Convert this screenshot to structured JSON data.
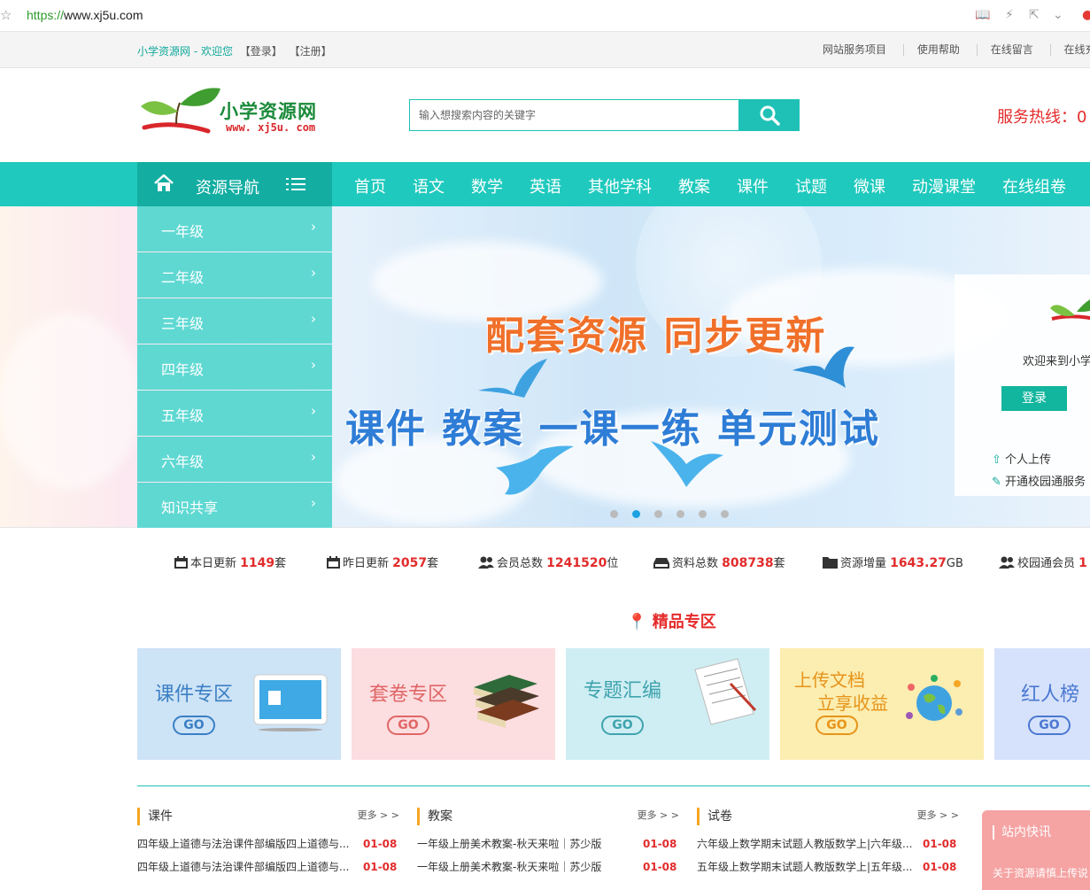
{
  "browser": {
    "url_scheme": "https://",
    "url_rest": "www.xj5u.com"
  },
  "topbar": {
    "site_link": "小学资源网 - 欢迎您",
    "login_link": "【登录】",
    "register_link": "【注册】",
    "links": [
      "网站服务项目",
      "使用帮助",
      "在线留言",
      "在线充"
    ]
  },
  "header": {
    "logo_name": "小学资源网",
    "logo_domain": "www. xj5u. com",
    "search_placeholder": "输入想搜索内容的关键字",
    "hotline": "服务热线：0"
  },
  "nav": {
    "resource_nav": "资源导航",
    "items": [
      "首页",
      "语文",
      "数学",
      "英语",
      "其他学科",
      "教案",
      "课件",
      "试题",
      "微课",
      "动漫课堂",
      "在线组卷"
    ]
  },
  "grades": [
    "一年级",
    "二年级",
    "三年级",
    "四年级",
    "五年级",
    "六年级",
    "知识共享"
  ],
  "banner": {
    "headline": "配套资源 同步更新",
    "subline": "课件 教案 一课一练 单元测试",
    "dots": 6,
    "active_dot": 1
  },
  "login_card": {
    "welcome": "欢迎来到小学",
    "login_button": "登录",
    "personal_upload": "个人上传",
    "campus_service": "开通校园通服务"
  },
  "stats": [
    {
      "label": "本日更新",
      "value": "1149",
      "unit": "套"
    },
    {
      "label": "昨日更新",
      "value": "2057",
      "unit": "套"
    },
    {
      "label": "会员总数",
      "value": "1241520",
      "unit": "位"
    },
    {
      "label": "资料总数",
      "value": "808738",
      "unit": "套"
    },
    {
      "label": "资源增量",
      "value": "1643.27",
      "unit": "GB"
    },
    {
      "label": "校园通会员",
      "value": "1",
      "unit": ""
    }
  ],
  "premium_title": "精品专区",
  "zones": [
    {
      "title": "课件专区",
      "go": "GO",
      "bg": "#cde3f6",
      "fg": "#3b7fc4"
    },
    {
      "title": "套卷专区",
      "go": "GO",
      "bg": "#fcdde0",
      "fg": "#e06666"
    },
    {
      "title": "专题汇编",
      "go": "GO",
      "bg": "#cfeef3",
      "fg": "#3fa3ae"
    },
    {
      "title": "上传文档",
      "title2": "立享收益",
      "go": "GO",
      "bg": "#fcedb0",
      "fg": "#e6941a"
    },
    {
      "title": "红人榜",
      "go": "GO",
      "bg": "#d6e2fb",
      "fg": "#4b78d1"
    }
  ],
  "columns": [
    {
      "title": "课件",
      "more": "更多 > >",
      "items": [
        {
          "text": "四年级上道德与法治课件部编版四上道德与...",
          "date": "01-08"
        },
        {
          "text": "四年级上道德与法治课件部编版四上道德与...",
          "date": "01-08"
        }
      ]
    },
    {
      "title": "教案",
      "more": "更多 > >",
      "items": [
        {
          "text": "一年级上册美术教案-秋天来啦｜苏少版",
          "date": "01-08"
        },
        {
          "text": "一年级上册美术教案-秋天来啦｜苏少版",
          "date": "01-08"
        }
      ]
    },
    {
      "title": "试卷",
      "more": "更多 > >",
      "items": [
        {
          "text": "六年级上数学期末试题人教版数学上|六年级...",
          "date": "01-08"
        },
        {
          "text": "五年级上数学期末试题人教版数学上|五年级...",
          "date": "01-08"
        }
      ]
    }
  ],
  "news": {
    "title": "站内快讯",
    "item": "关于资源请慎上传说"
  }
}
